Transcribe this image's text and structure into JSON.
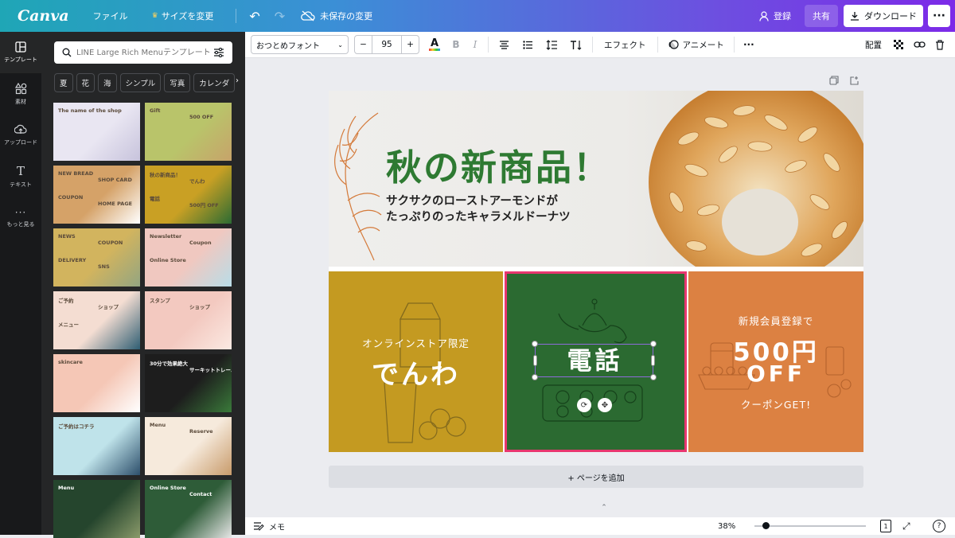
{
  "topbar": {
    "logo": "Canva",
    "file": "ファイル",
    "resize": "サイズを変更",
    "status": "未保存の変更",
    "signup": "登録",
    "share": "共有",
    "download": "ダウンロード"
  },
  "leftnav": {
    "items": [
      {
        "label": "テンプレート",
        "icon": "template-icon"
      },
      {
        "label": "素材",
        "icon": "elements-icon"
      },
      {
        "label": "アップロード",
        "icon": "upload-icon"
      },
      {
        "label": "テキスト",
        "icon": "text-icon"
      },
      {
        "label": "もっと見る",
        "icon": "more-icon"
      }
    ]
  },
  "panel": {
    "search_placeholder": "LINE Large Rich Menuテンプレート",
    "chips": [
      "夏",
      "花",
      "海",
      "シンプル",
      "写真",
      "カレンダ"
    ],
    "thumbnails": [
      {
        "texts": [
          "The name of the shop"
        ],
        "colors": [
          "#e9e6f2",
          "#c7c3dc"
        ]
      },
      {
        "texts": [
          "Gift",
          "500 OFF"
        ],
        "colors": [
          "#b9c46a",
          "#c7a36a"
        ]
      },
      {
        "texts": [
          "NEW BREAD",
          "SHOP CARD",
          "COUPON",
          "HOME PAGE"
        ],
        "colors": [
          "#d5a268",
          "#fff"
        ]
      },
      {
        "texts": [
          "秋の新商品！",
          "でんわ",
          "電話",
          "500円 OFF"
        ],
        "colors": [
          "#c9a024",
          "#2c6b33"
        ]
      },
      {
        "texts": [
          "NEWS",
          "COUPON",
          "DELIVERY",
          "SNS"
        ],
        "colors": [
          "#d2b45e",
          "#93a581"
        ]
      },
      {
        "texts": [
          "Newsletter",
          "Coupon",
          "Online Store"
        ],
        "colors": [
          "#f0c8c0",
          "#b8dde8"
        ]
      },
      {
        "texts": [
          "ご予約",
          "ショップ",
          "メニュー"
        ],
        "colors": [
          "#f4ddd2",
          "#2f5e73"
        ]
      },
      {
        "texts": [
          "スタンプ",
          "ショップ"
        ],
        "colors": [
          "#f3c9c0",
          "#fbe9e2"
        ]
      },
      {
        "texts": [
          "skincare"
        ],
        "colors": [
          "#f5c7b6",
          "#fff"
        ]
      },
      {
        "texts": [
          "30分で効果絶大",
          "サーキットトレーニング"
        ],
        "colors": [
          "#1d1d1d",
          "#3a7a3a"
        ]
      },
      {
        "texts": [
          "ご予約はコチラ"
        ],
        "colors": [
          "#bfe3ea",
          "#2d4f6b"
        ]
      },
      {
        "texts": [
          "Menu",
          "Reserve"
        ],
        "colors": [
          "#f6eadc",
          "#c89b6b"
        ]
      },
      {
        "texts": [
          "Menu"
        ],
        "colors": [
          "#25452d",
          "#8a9a6a"
        ]
      },
      {
        "texts": [
          "Online Store",
          "Contact"
        ],
        "colors": [
          "#2e5c38",
          "#e6e6e6"
        ]
      }
    ]
  },
  "toolbar": {
    "font": "おつとめフォント",
    "font_size": "95",
    "minus": "−",
    "plus": "+",
    "effects": "エフェクト",
    "animate": "アニメート",
    "position": "配置"
  },
  "design": {
    "title": "秋の新商品！",
    "subtitle_line1": "サクサクのローストアーモンドが",
    "subtitle_line2": "たっぷりのったキャラメルドーナツ",
    "cell1_small": "オンラインストア限定",
    "cell1_big": "でんわ",
    "cell2_big": "電話",
    "cell3_small": "新規会員登録で",
    "cell3_big1": "500円",
    "cell3_big2": "OFF",
    "cell3_bottom": "クーポンGET!",
    "colors": {
      "mustard": "#c49a21",
      "green": "#2b6a31",
      "orange": "#dc8142",
      "title_green": "#2e7a32",
      "select": "#e8366f"
    }
  },
  "canvas": {
    "add_page": "+ ページを追加"
  },
  "statusbar": {
    "notes": "メモ",
    "zoom": "38%",
    "zoom_level": 0.1,
    "page_num": "1",
    "help": "?"
  }
}
